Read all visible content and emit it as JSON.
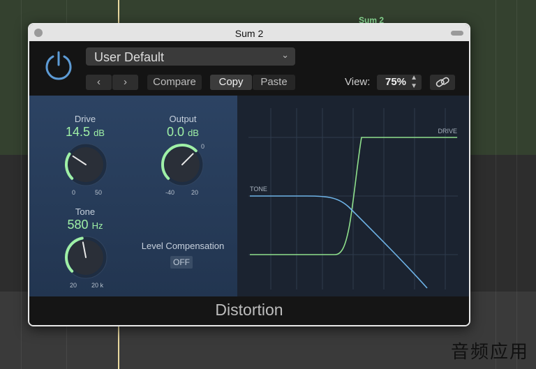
{
  "background": {
    "region_label": "Sum 2",
    "watermark": "音频应用"
  },
  "window": {
    "title": "Sum 2"
  },
  "header": {
    "preset": "User Default",
    "prev_label": "‹",
    "next_label": "›",
    "compare_label": "Compare",
    "copy_label": "Copy",
    "paste_label": "Paste",
    "view_label": "View:",
    "view_value": "75%"
  },
  "controls": {
    "drive": {
      "label": "Drive",
      "value": "14.5",
      "unit": "dB",
      "min": "0",
      "max": "50",
      "level": 0.29
    },
    "output": {
      "label": "Output",
      "value": "0.0",
      "unit": "dB",
      "min": "-40",
      "max": "20",
      "zero": "0",
      "level": 0.667
    },
    "tone": {
      "label": "Tone",
      "value": "580",
      "unit": "Hz",
      "min": "20",
      "max": "20 k",
      "level": 0.46
    },
    "level_compensation": {
      "label": "Level Compensation",
      "state": "OFF"
    }
  },
  "graph": {
    "drive_label": "DRIVE",
    "tone_label": "TONE"
  },
  "footer": {
    "plugin_name": "Distortion"
  },
  "colors": {
    "accent_green": "#9ff0a6",
    "curve_green": "#8fe08c",
    "curve_blue": "#6fb4e8",
    "power_blue": "#5d9bd5"
  }
}
